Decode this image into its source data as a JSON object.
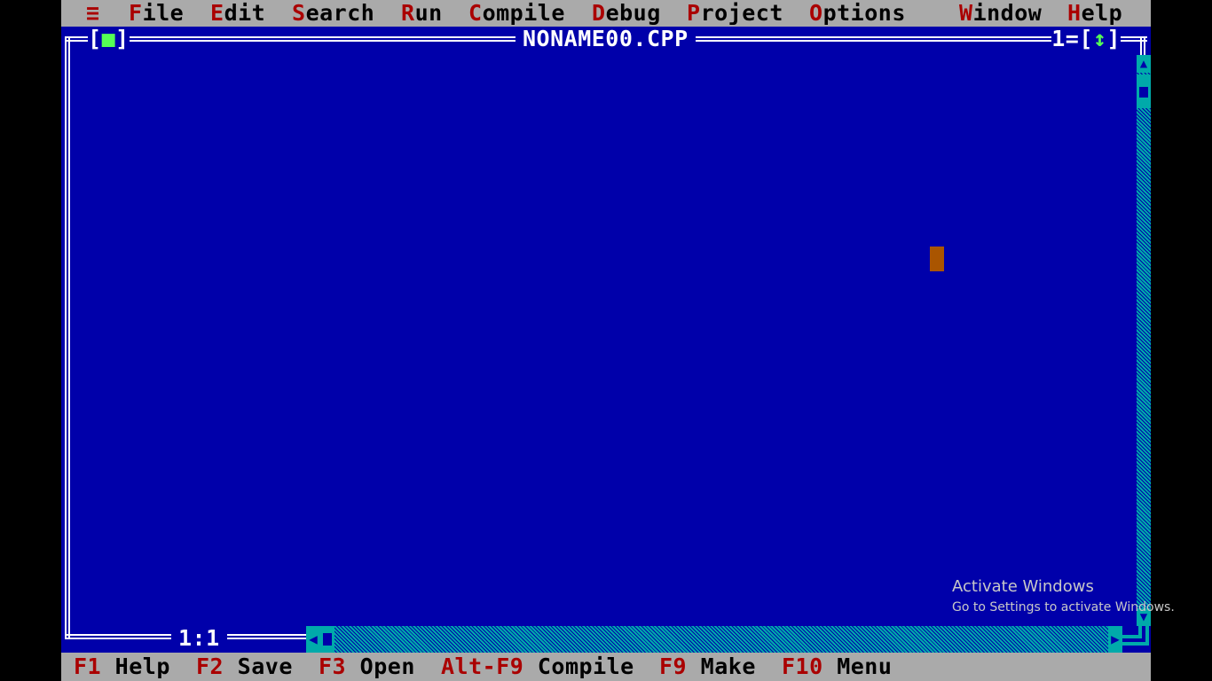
{
  "menubar": {
    "system_icon": "≡",
    "items": [
      {
        "hot": "F",
        "rest": "ile"
      },
      {
        "hot": "E",
        "rest": "dit"
      },
      {
        "hot": "S",
        "rest": "earch"
      },
      {
        "hot": "R",
        "rest": "un"
      },
      {
        "hot": "C",
        "rest": "ompile"
      },
      {
        "hot": "D",
        "rest": "ebug"
      },
      {
        "hot": "P",
        "rest": "roject"
      },
      {
        "hot": "O",
        "rest": "ptions"
      },
      {
        "hot": "W",
        "rest": "indow"
      },
      {
        "hot": "H",
        "rest": "elp"
      }
    ]
  },
  "window": {
    "close_box_left": "[",
    "close_box_mark": "■",
    "close_box_right": "]",
    "title": "NONAME00.CPP",
    "number": "1",
    "zoom_left": "=[",
    "zoom_mark": "↕",
    "zoom_right": "]",
    "cursor_position": "1:1"
  },
  "statusbar": {
    "items": [
      {
        "key": "F1",
        "label": " Help"
      },
      {
        "key": "F2",
        "label": " Save"
      },
      {
        "key": "F3",
        "label": " Open"
      },
      {
        "key": "Alt-F9",
        "label": " Compile"
      },
      {
        "key": "F9",
        "label": " Make"
      },
      {
        "key": "F10",
        "label": " Menu"
      }
    ]
  },
  "watermark": {
    "line1": "Activate Windows",
    "line2": "Go to Settings to activate Windows."
  },
  "colors": {
    "desktop": "#0000aa",
    "menu_bg": "#aaaaaa",
    "hotkey": "#aa0000",
    "frame": "#ffffff",
    "scrollbar": "#00aaaa",
    "cursor": "#aa5500"
  }
}
